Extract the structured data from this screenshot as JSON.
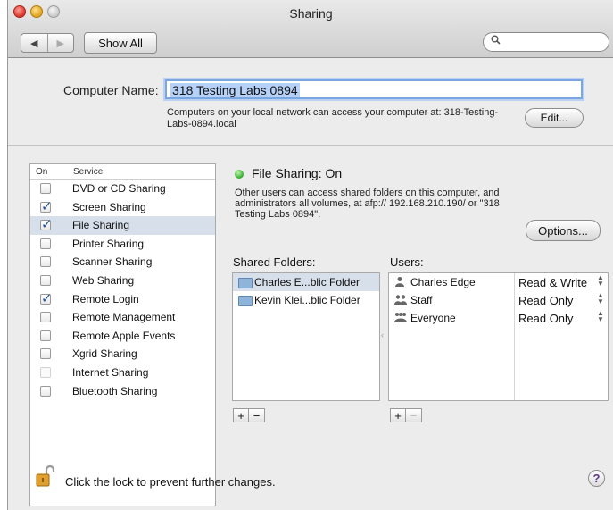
{
  "window": {
    "title": "Sharing"
  },
  "toolbar": {
    "back_label": "◀",
    "forward_label": "▶",
    "show_all_label": "Show All",
    "search_icon": "magnifier-icon"
  },
  "computer": {
    "name_label": "Computer Name:",
    "name_value": "318 Testing Labs 0894",
    "network_info": "Computers on your local network can access your computer at: 318-Testing-Labs-0894.local",
    "edit_label": "Edit..."
  },
  "services": {
    "header_on": "On",
    "header_service": "Service",
    "items": [
      {
        "label": "DVD or CD Sharing",
        "checked": false
      },
      {
        "label": "Screen Sharing",
        "checked": true
      },
      {
        "label": "File Sharing",
        "checked": true,
        "selected": true
      },
      {
        "label": "Printer Sharing",
        "checked": false
      },
      {
        "label": "Scanner Sharing",
        "checked": false
      },
      {
        "label": "Web Sharing",
        "checked": false
      },
      {
        "label": "Remote Login",
        "checked": true
      },
      {
        "label": "Remote Management",
        "checked": false
      },
      {
        "label": "Remote Apple Events",
        "checked": false
      },
      {
        "label": "Xgrid Sharing",
        "checked": false
      },
      {
        "label": "Internet Sharing",
        "checked": false,
        "disabled": true
      },
      {
        "label": "Bluetooth Sharing",
        "checked": false
      }
    ]
  },
  "status": {
    "title": "File Sharing: On",
    "description": "Other users can access shared folders on this computer, and administrators all volumes, at afp:// 192.168.210.190/ or \"318 Testing Labs 0894\".",
    "options_label": "Options...",
    "dot_color": "#2fa82a"
  },
  "shared_folders": {
    "label": "Shared Folders:",
    "items": [
      {
        "name": "Charles E...blic Folder",
        "selected": true
      },
      {
        "name": "Kevin Klei...blic Folder",
        "selected": false
      }
    ],
    "add_label": "+",
    "remove_label": "−"
  },
  "users": {
    "label": "Users:",
    "items": [
      {
        "name": "Charles Edge",
        "permission": "Read & Write",
        "icon": "user-icon"
      },
      {
        "name": "Staff",
        "permission": "Read Only",
        "icon": "group-icon"
      },
      {
        "name": "Everyone",
        "permission": "Read Only",
        "icon": "everyone-icon"
      }
    ],
    "add_label": "+",
    "remove_label": "−"
  },
  "footer": {
    "lock_text": "Click the lock to prevent further changes.",
    "help_label": "?"
  }
}
